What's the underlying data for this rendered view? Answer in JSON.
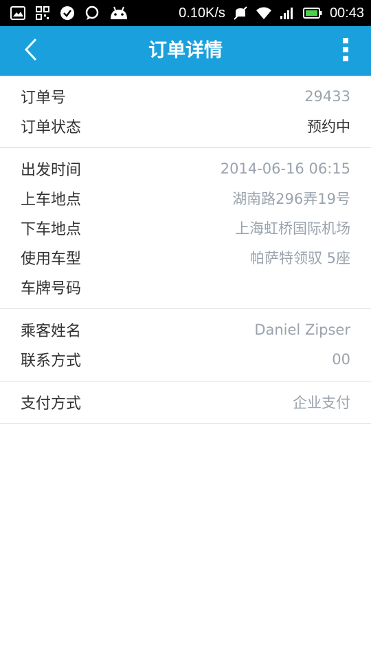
{
  "status_bar": {
    "speed": "0.10K/s",
    "time": "00:43",
    "icons": [
      "image-icon",
      "qr-code-icon",
      "check-circle-icon",
      "chat-bubble-icon",
      "android-icon",
      "mute-icon",
      "wifi-icon",
      "signal-icon",
      "battery-icon"
    ]
  },
  "header": {
    "title": "订单详情",
    "back_icon": "chevron-left-icon",
    "more_icon": "more-vertical-icon"
  },
  "order": {
    "number_label": "订单号",
    "number_value": "29433",
    "status_label": "订单状态",
    "status_value": "预约中"
  },
  "trip": {
    "depart_label": "出发时间",
    "depart_value": "2014-06-16 06:15",
    "pickup_label": "上车地点",
    "pickup_value": "湖南路296弄19号",
    "dropoff_label": "下车地点",
    "dropoff_value": "上海虹桥国际机场",
    "car_type_label": "使用车型",
    "car_type_value": "帕萨特领驭 5座",
    "plate_label": "车牌号码",
    "plate_value": ""
  },
  "passenger": {
    "name_label": "乘客姓名",
    "name_value": "Daniel Zipser",
    "contact_label": "联系方式",
    "contact_value": "00"
  },
  "payment": {
    "method_label": "支付方式",
    "method_value": "企业支付"
  },
  "colors": {
    "app_bar": "#1aa1dd",
    "value_text": "#9aa3ad",
    "label_text": "#333333"
  }
}
